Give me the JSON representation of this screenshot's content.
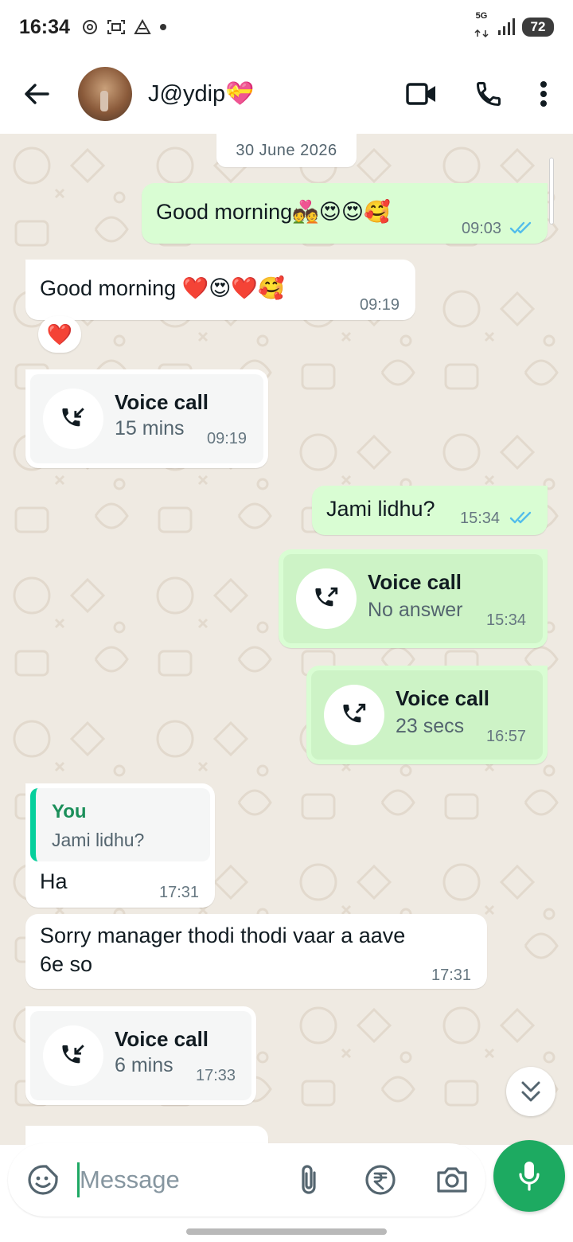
{
  "status_bar": {
    "time": "16:34",
    "network_label_top": "5G",
    "battery": "72"
  },
  "header": {
    "contact_name": "J@ydip💝"
  },
  "chat": {
    "date_chip": "30 June 2026",
    "messages": [
      {
        "type": "text",
        "direction": "outgoing",
        "text": "Good morning💑😍😍🥰",
        "time": "09:03",
        "status": "read"
      },
      {
        "type": "text",
        "direction": "incoming",
        "text": "Good morning ❤️😍❤️🥰",
        "time": "09:19",
        "reaction": "❤️"
      },
      {
        "type": "call",
        "direction": "incoming",
        "title": "Voice call",
        "subtitle": "15 mins",
        "time": "09:19"
      },
      {
        "type": "text",
        "direction": "outgoing",
        "text": "Jami lidhu?",
        "time": "15:34",
        "status": "read"
      },
      {
        "type": "call",
        "direction": "outgoing",
        "title": "Voice call",
        "subtitle": "No answer",
        "time": "15:34"
      },
      {
        "type": "call",
        "direction": "outgoing",
        "title": "Voice call",
        "subtitle": "23 secs",
        "time": "16:57"
      },
      {
        "type": "reply",
        "direction": "incoming",
        "quote_author": "You",
        "quote_text": "Jami lidhu?",
        "text": "Ha",
        "time": "17:31"
      },
      {
        "type": "text",
        "direction": "incoming",
        "text_line1": "Sorry manager thodi thodi vaar a aave",
        "text_line2": "6e so",
        "time": "17:31"
      },
      {
        "type": "call",
        "direction": "incoming",
        "title": "Voice call",
        "subtitle": "6 mins",
        "time": "17:33"
      }
    ]
  },
  "composer": {
    "placeholder": "Message"
  },
  "colors": {
    "accent_green": "#1daa61",
    "outgoing_bubble": "#d9fdd3",
    "chat_background": "#efeae2",
    "read_ticks": "#53bdeb"
  },
  "icons": [
    "back-arrow-icon",
    "video-call-icon",
    "phone-icon",
    "more-options-icon",
    "incoming-call-icon",
    "outgoing-call-icon",
    "double-chevron-down-icon",
    "sticker-icon",
    "attach-icon",
    "rupee-icon",
    "camera-icon",
    "mic-icon"
  ]
}
